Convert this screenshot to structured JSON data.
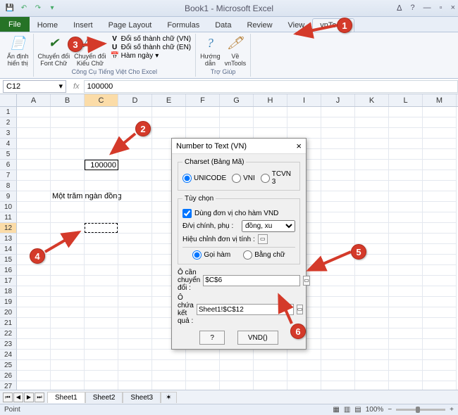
{
  "window": {
    "title": "Book1 - Microsoft Excel"
  },
  "qat": {
    "save": "💾",
    "undo": "↶",
    "redo": "↷"
  },
  "win_controls": {
    "help1": "ᐃ",
    "help2": "?",
    "min": "—",
    "restore": "▫",
    "close": "×"
  },
  "tabs": {
    "file": "File",
    "items": [
      "Home",
      "Insert",
      "Page Layout",
      "Formulas",
      "Data",
      "Review",
      "View",
      "vnTools"
    ],
    "active": "vnTools"
  },
  "ribbon": {
    "group1_label": "",
    "btn1": "Ẩn định\nhiển thị",
    "group2_label": "Công Cụ Tiếng Việt Cho Excel",
    "btn2": "Chuyển đổi\nFont Chữ",
    "btn3": "Chuyển đổi\nKiểu Chữ",
    "convert_vn": "Đổi số thành chữ (VN)",
    "convert_en": "Đổi số thành chữ (EN)",
    "ham_ngay": "Hàm ngày",
    "group3_label": "Trợ Giúp",
    "btn4": "Hướng\ndẫn",
    "btn5": "Về\nvnTools"
  },
  "formula_bar": {
    "namebox": "C12",
    "value": "100000",
    "fx": "fx"
  },
  "columns": [
    "A",
    "B",
    "C",
    "D",
    "E",
    "F",
    "G",
    "H",
    "I",
    "J",
    "K",
    "L",
    "M"
  ],
  "cells": {
    "c6": "100000",
    "b9": "Một trăm ngàn đồng"
  },
  "dialog": {
    "title": "Number to Text (VN)",
    "charset_label": "Charset (Bảng Mã)",
    "charset_unicode": "UNICODE",
    "charset_vni": "VNI",
    "charset_tcvn": "TCVN 3",
    "options_label": "Tùy chọn",
    "use_vnd": "Dùng đơn vị cho hàm VND",
    "unit_label": "Đ/vị chính, phụ :",
    "unit_value": "đồng, xu",
    "currency_label": "Hiệu chỉnh đơn vị tính :",
    "call_func": "Gọi hàm",
    "by_text": "Bằng chữ",
    "src_label": "Ô cần chuyển đổi :",
    "src_value": "$C$6",
    "dst_label": "Ô chứa kết quả :",
    "dst_value": "Sheet1!$C$12",
    "btn_help": "?",
    "btn_vnd": "VND()"
  },
  "sheets": {
    "tabs": [
      "Sheet1",
      "Sheet2",
      "Sheet3"
    ],
    "active": "Sheet1"
  },
  "status": {
    "left": "Point",
    "zoom": "100%"
  },
  "callouts": {
    "c1": "1",
    "c2": "2",
    "c3": "3",
    "c4": "4",
    "c5": "5",
    "c6": "6"
  }
}
